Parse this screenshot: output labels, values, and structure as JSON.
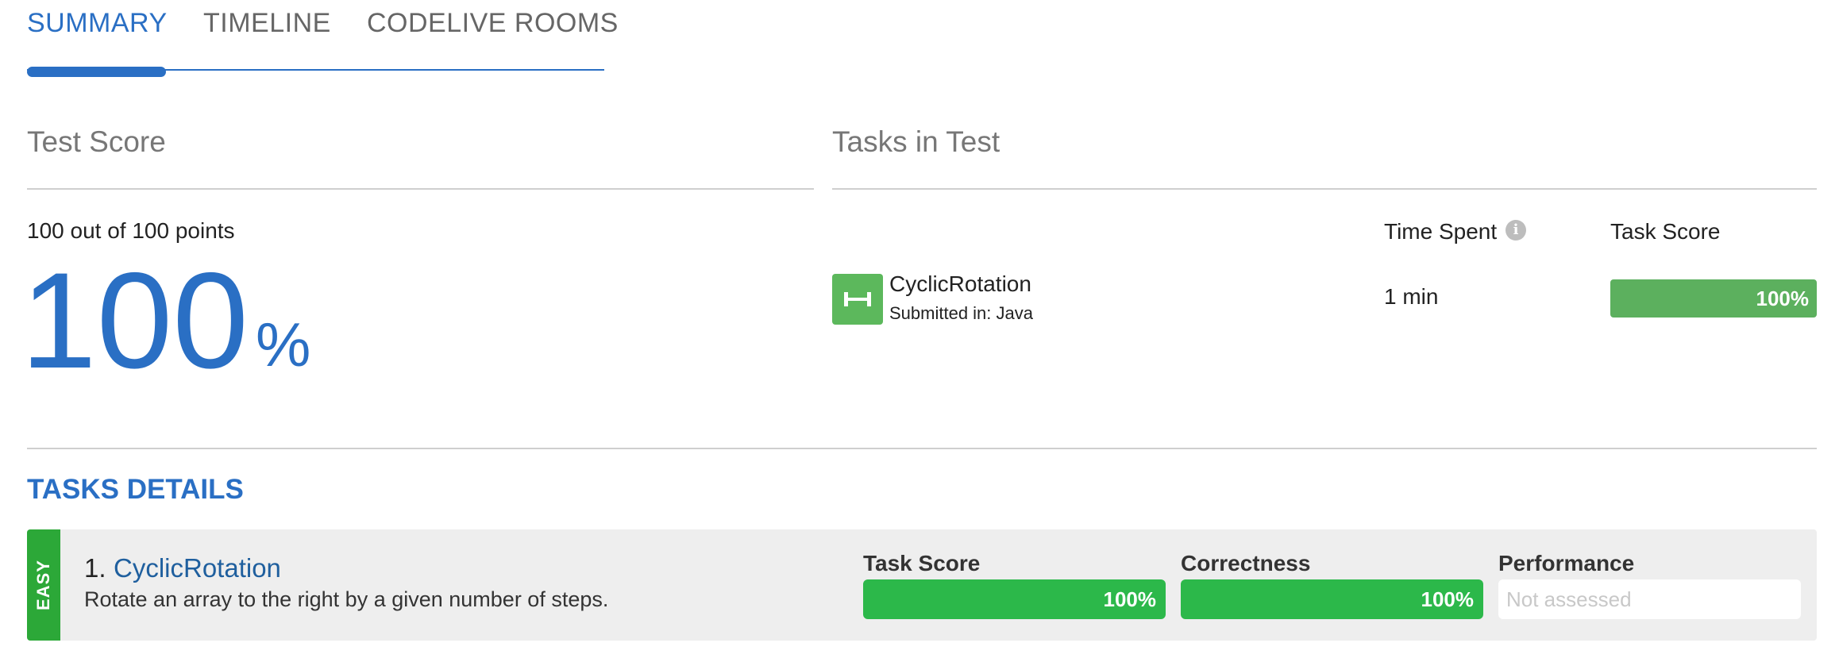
{
  "tabs": [
    {
      "label": "SUMMARY",
      "active": true
    },
    {
      "label": "TIMELINE",
      "active": false
    },
    {
      "label": "CODELIVE ROOMS",
      "active": false
    }
  ],
  "test_score": {
    "title": "Test Score",
    "points_text": "100 out of 100 points",
    "percent_value": "100",
    "percent_sign": "%"
  },
  "tasks_in_test": {
    "title": "Tasks in Test",
    "columns": {
      "time_spent": "Time Spent",
      "task_score": "Task Score"
    },
    "info_icon": "i",
    "rows": [
      {
        "icon": "dumbbell-icon",
        "name": "CyclicRotation",
        "submitted": "Submitted in: Java",
        "time": "1 min",
        "score_label": "100%",
        "score": 1.0
      }
    ]
  },
  "tasks_details": {
    "title": "TASKS DETAILS",
    "items": [
      {
        "difficulty": "EASY",
        "number": "1.",
        "name": "CyclicRotation",
        "description": "Rotate an array to the right by a given number of steps.",
        "metrics": [
          {
            "label": "Task Score",
            "value": "100%",
            "fraction": 1.0
          },
          {
            "label": "Correctness",
            "value": "100%",
            "fraction": 1.0
          },
          {
            "label": "Performance",
            "value": "Not assessed",
            "fraction": null
          }
        ]
      }
    ]
  },
  "colors": {
    "accent": "#2a6fc4",
    "link": "#1f5f9e",
    "success": "#2cb84a",
    "task_score": "#5cb05e",
    "easy": "#2ca838"
  }
}
